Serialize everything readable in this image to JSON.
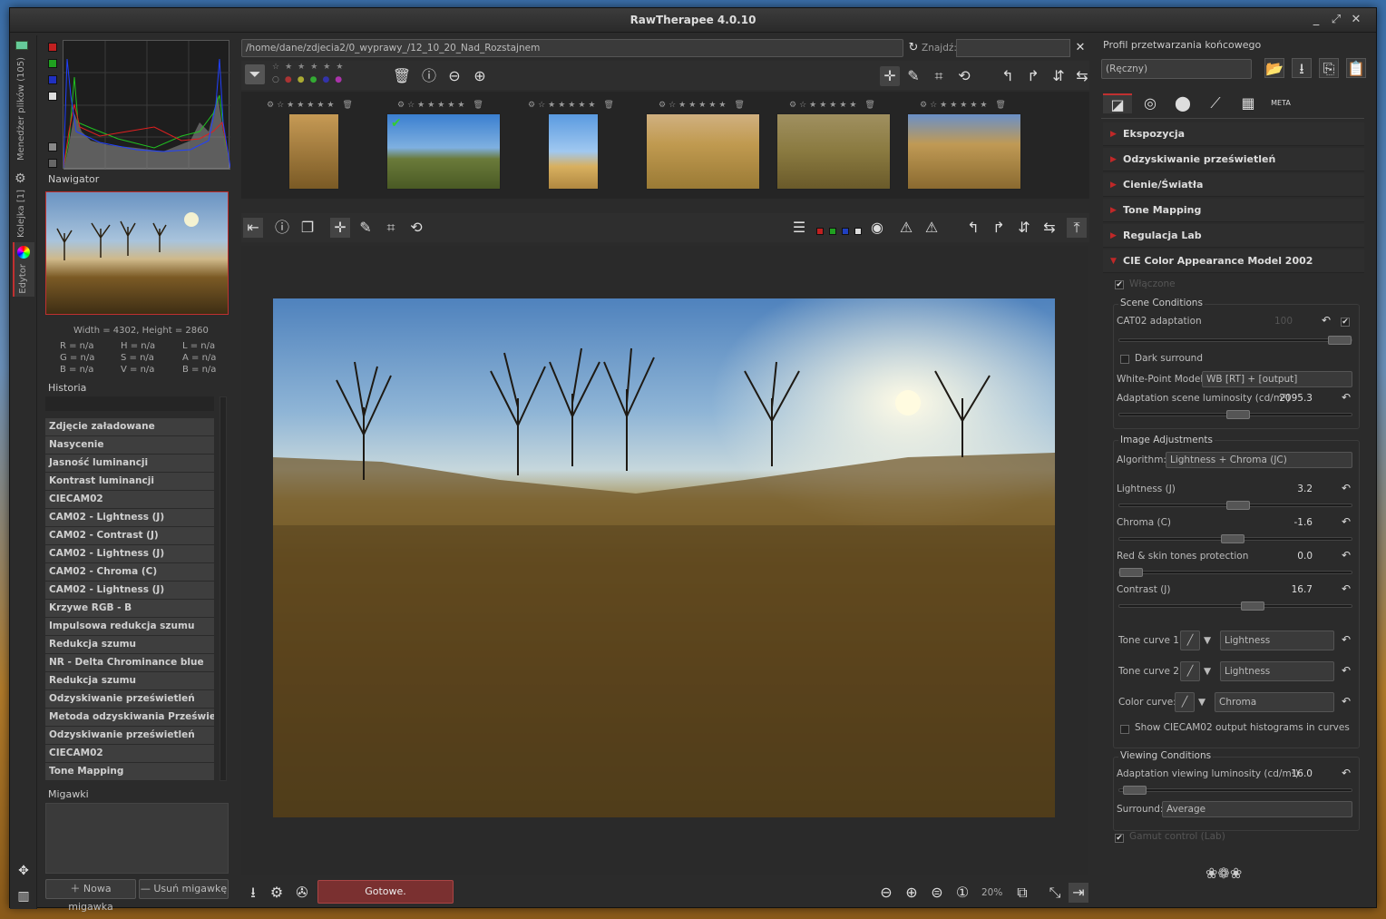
{
  "window": {
    "title": "RawTherapee 4.0.10",
    "minimize": "_",
    "maximize": "⤢",
    "close": "✕"
  },
  "vtabs": {
    "file_browser": "Menedżer plików (105)",
    "queue": "Kolejka [1]",
    "editor": "Edytor"
  },
  "left": {
    "navigator_label": "Nawigator",
    "dims": "Width = 4302, Height = 2860",
    "readout": [
      [
        "R = n/a",
        "H = n/a",
        "L = n/a"
      ],
      [
        "G = n/a",
        "S = n/a",
        "A = n/a"
      ],
      [
        "B = n/a",
        "V = n/a",
        "B = n/a"
      ]
    ],
    "history_label": "Historia",
    "history": [
      "Zdjęcie załadowane",
      "Nasycenie",
      "Jasność luminancji",
      "Kontrast luminancji",
      "CIECAM02",
      "CAM02 - Lightness (J)",
      "CAM02 - Contrast (J)",
      "CAM02 - Lightness (J)",
      "CAM02 - Chroma (C)",
      "CAM02 - Lightness (J)",
      "Krzywe RGB - B",
      "Impulsowa redukcja szumu",
      "Redukcja szumu",
      "NR - Delta Chrominance blue",
      "Redukcja szumu",
      "Odzyskiwanie prześwietleń",
      "Metoda odzyskiwania Prześwietleń",
      "Odzyskiwanie prześwietleń",
      "CIECAM02",
      "Tone Mapping",
      "CIECAM02"
    ],
    "snapshots_label": "Migawki",
    "new_snapshot": "Nowa migawka",
    "del_snapshot": "Usuń migawkę"
  },
  "browser": {
    "path": "/home/dane/zdjecia2/0_wyprawy_/12_10_20_Nad_Rozstajnem",
    "find_label": "Znajdź:",
    "find_value": "",
    "close": "✕"
  },
  "status": {
    "text": "Gotowe.",
    "zoom": "20%"
  },
  "right": {
    "profile_label": "Profil przetwarzania końcowego",
    "profile_value": "(Ręczny)",
    "meta_tab": "META",
    "sections": [
      "Ekspozycja",
      "Odzyskiwanie prześwietleń",
      "Cienie/Światła",
      "Tone Mapping",
      "Regulacja Lab",
      "CIE Color Appearance Model 2002"
    ],
    "enabled": "Włączone",
    "scene": {
      "title": "Scene Conditions",
      "cat02": "CAT02 adaptation",
      "cat02_val": "100",
      "dark": "Dark surround",
      "wp_label": "White-Point Model:",
      "wp_value": "WB [RT] + [output]",
      "lum_label": "Adaptation scene luminosity (cd/m²)",
      "lum_val": "2095.3"
    },
    "image": {
      "title": "Image Adjustments",
      "alg_label": "Algorithm:",
      "alg_value": "Lightness + Chroma (JC)",
      "lightness": "Lightness (J)",
      "lightness_val": "3.2",
      "chroma": "Chroma (C)",
      "chroma_val": "-1.6",
      "redskin": "Red & skin tones protection",
      "redskin_val": "0.0",
      "contrast": "Contrast (J)",
      "contrast_val": "16.7",
      "tc1": "Tone curve 1:",
      "tc1_val": "Lightness",
      "tc2": "Tone curve 2:",
      "tc2_val": "Lightness",
      "cc": "Color curve:",
      "cc_val": "Chroma",
      "showhist": "Show CIECAM02 output histograms in curves"
    },
    "viewing": {
      "title": "Viewing Conditions",
      "lum_label": "Adaptation viewing luminosity (cd/m²)",
      "lum_val": "16.0",
      "surround_label": "Surround:",
      "surround_value": "Average",
      "gamut": "Gamut control (Lab)"
    }
  }
}
